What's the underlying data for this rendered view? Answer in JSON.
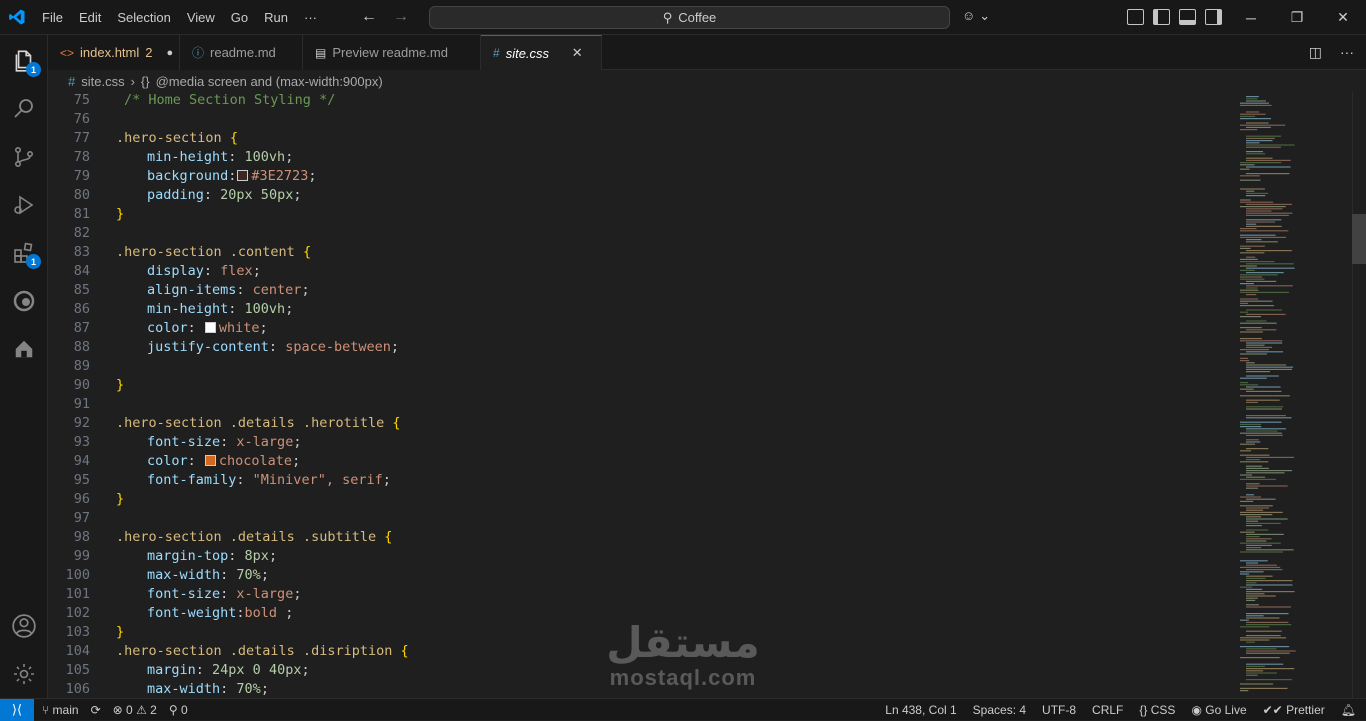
{
  "menu": [
    "File",
    "Edit",
    "Selection",
    "View",
    "Go",
    "Run",
    "···"
  ],
  "search": {
    "label": "Coffee"
  },
  "tabs": [
    {
      "label": "index.html",
      "icon": "<>",
      "modified": "2",
      "dot": "●"
    },
    {
      "label": "readme.md",
      "icon": "ⓘ"
    },
    {
      "label": "Preview readme.md",
      "icon": "▤"
    },
    {
      "label": "site.css",
      "icon": "#",
      "close": "✕"
    }
  ],
  "breadcrumb": {
    "file": "site.css",
    "symbol": "@media screen and (max-width:900px)"
  },
  "badges": {
    "explorer": "1",
    "extensions": "1"
  },
  "code": [
    {
      "n": "75",
      "t": "cmt",
      "c": "/* Home Section Styling */"
    },
    {
      "n": "76"
    },
    {
      "n": "77",
      "sel": ".hero-section",
      "b": "{"
    },
    {
      "n": "78",
      "p": "min-height",
      "v": "100vh",
      "vt": "num"
    },
    {
      "n": "79",
      "p": "background",
      "v": "#3E2723",
      "vt": "val",
      "sw": "#3E2723",
      "nosp": true
    },
    {
      "n": "80",
      "p": "padding",
      "v": "20px 50px",
      "vt": "num"
    },
    {
      "n": "81",
      "close": "}"
    },
    {
      "n": "82"
    },
    {
      "n": "83",
      "sel": ".hero-section .content",
      "b": "{"
    },
    {
      "n": "84",
      "p": "display",
      "v": "flex",
      "vt": "val"
    },
    {
      "n": "85",
      "p": "align-items",
      "v": "center",
      "vt": "val"
    },
    {
      "n": "86",
      "p": "min-height",
      "v": "100vh",
      "vt": "num"
    },
    {
      "n": "87",
      "p": "color",
      "v": "white",
      "vt": "val",
      "sw": "#ffffff"
    },
    {
      "n": "88",
      "p": "justify-content",
      "v": "space-between",
      "vt": "val"
    },
    {
      "n": "89"
    },
    {
      "n": "90",
      "close": "}"
    },
    {
      "n": "91"
    },
    {
      "n": "92",
      "sel": ".hero-section .details .herotitle",
      "b": "{"
    },
    {
      "n": "93",
      "p": "font-size",
      "v": "x-large",
      "vt": "val"
    },
    {
      "n": "94",
      "p": "color",
      "v": "chocolate",
      "vt": "val",
      "sw": "#d2691e"
    },
    {
      "n": "95",
      "p": "font-family",
      "v": "\"Miniver\", serif",
      "vt": "val"
    },
    {
      "n": "96",
      "close": "}"
    },
    {
      "n": "97"
    },
    {
      "n": "98",
      "sel": ".hero-section .details .subtitle",
      "b": "{"
    },
    {
      "n": "99",
      "p": "margin-top",
      "v": "8px",
      "vt": "num"
    },
    {
      "n": "100",
      "p": "max-width",
      "v": "70%",
      "vt": "num"
    },
    {
      "n": "101",
      "p": "font-size",
      "v": "x-large",
      "vt": "val"
    },
    {
      "n": "102",
      "p": "font-weight",
      "v": "bold ",
      "vt": "val",
      "nosp": true
    },
    {
      "n": "103",
      "close": "}"
    },
    {
      "n": "104",
      "sel": ".hero-section .details .disription",
      "b": "{"
    },
    {
      "n": "105",
      "p": "margin",
      "v": "24px 0 40px",
      "vt": "num"
    },
    {
      "n": "106",
      "p": "max-width",
      "v": "70%",
      "vt": "num"
    }
  ],
  "status": {
    "branch": "main",
    "errors": "0",
    "warnings": "2",
    "ports": "0",
    "position": "Ln 438, Col 1",
    "spaces": "Spaces: 4",
    "encoding": "UTF-8",
    "eol": "CRLF",
    "language": "CSS",
    "golive": "Go Live",
    "prettier": "Prettier"
  },
  "watermark": {
    "ar": "مستقل",
    "en": "mostaql.com"
  },
  "colors": {
    "accent": "#0078d4",
    "background": "#1f1f1f",
    "sidebar": "#181818"
  }
}
